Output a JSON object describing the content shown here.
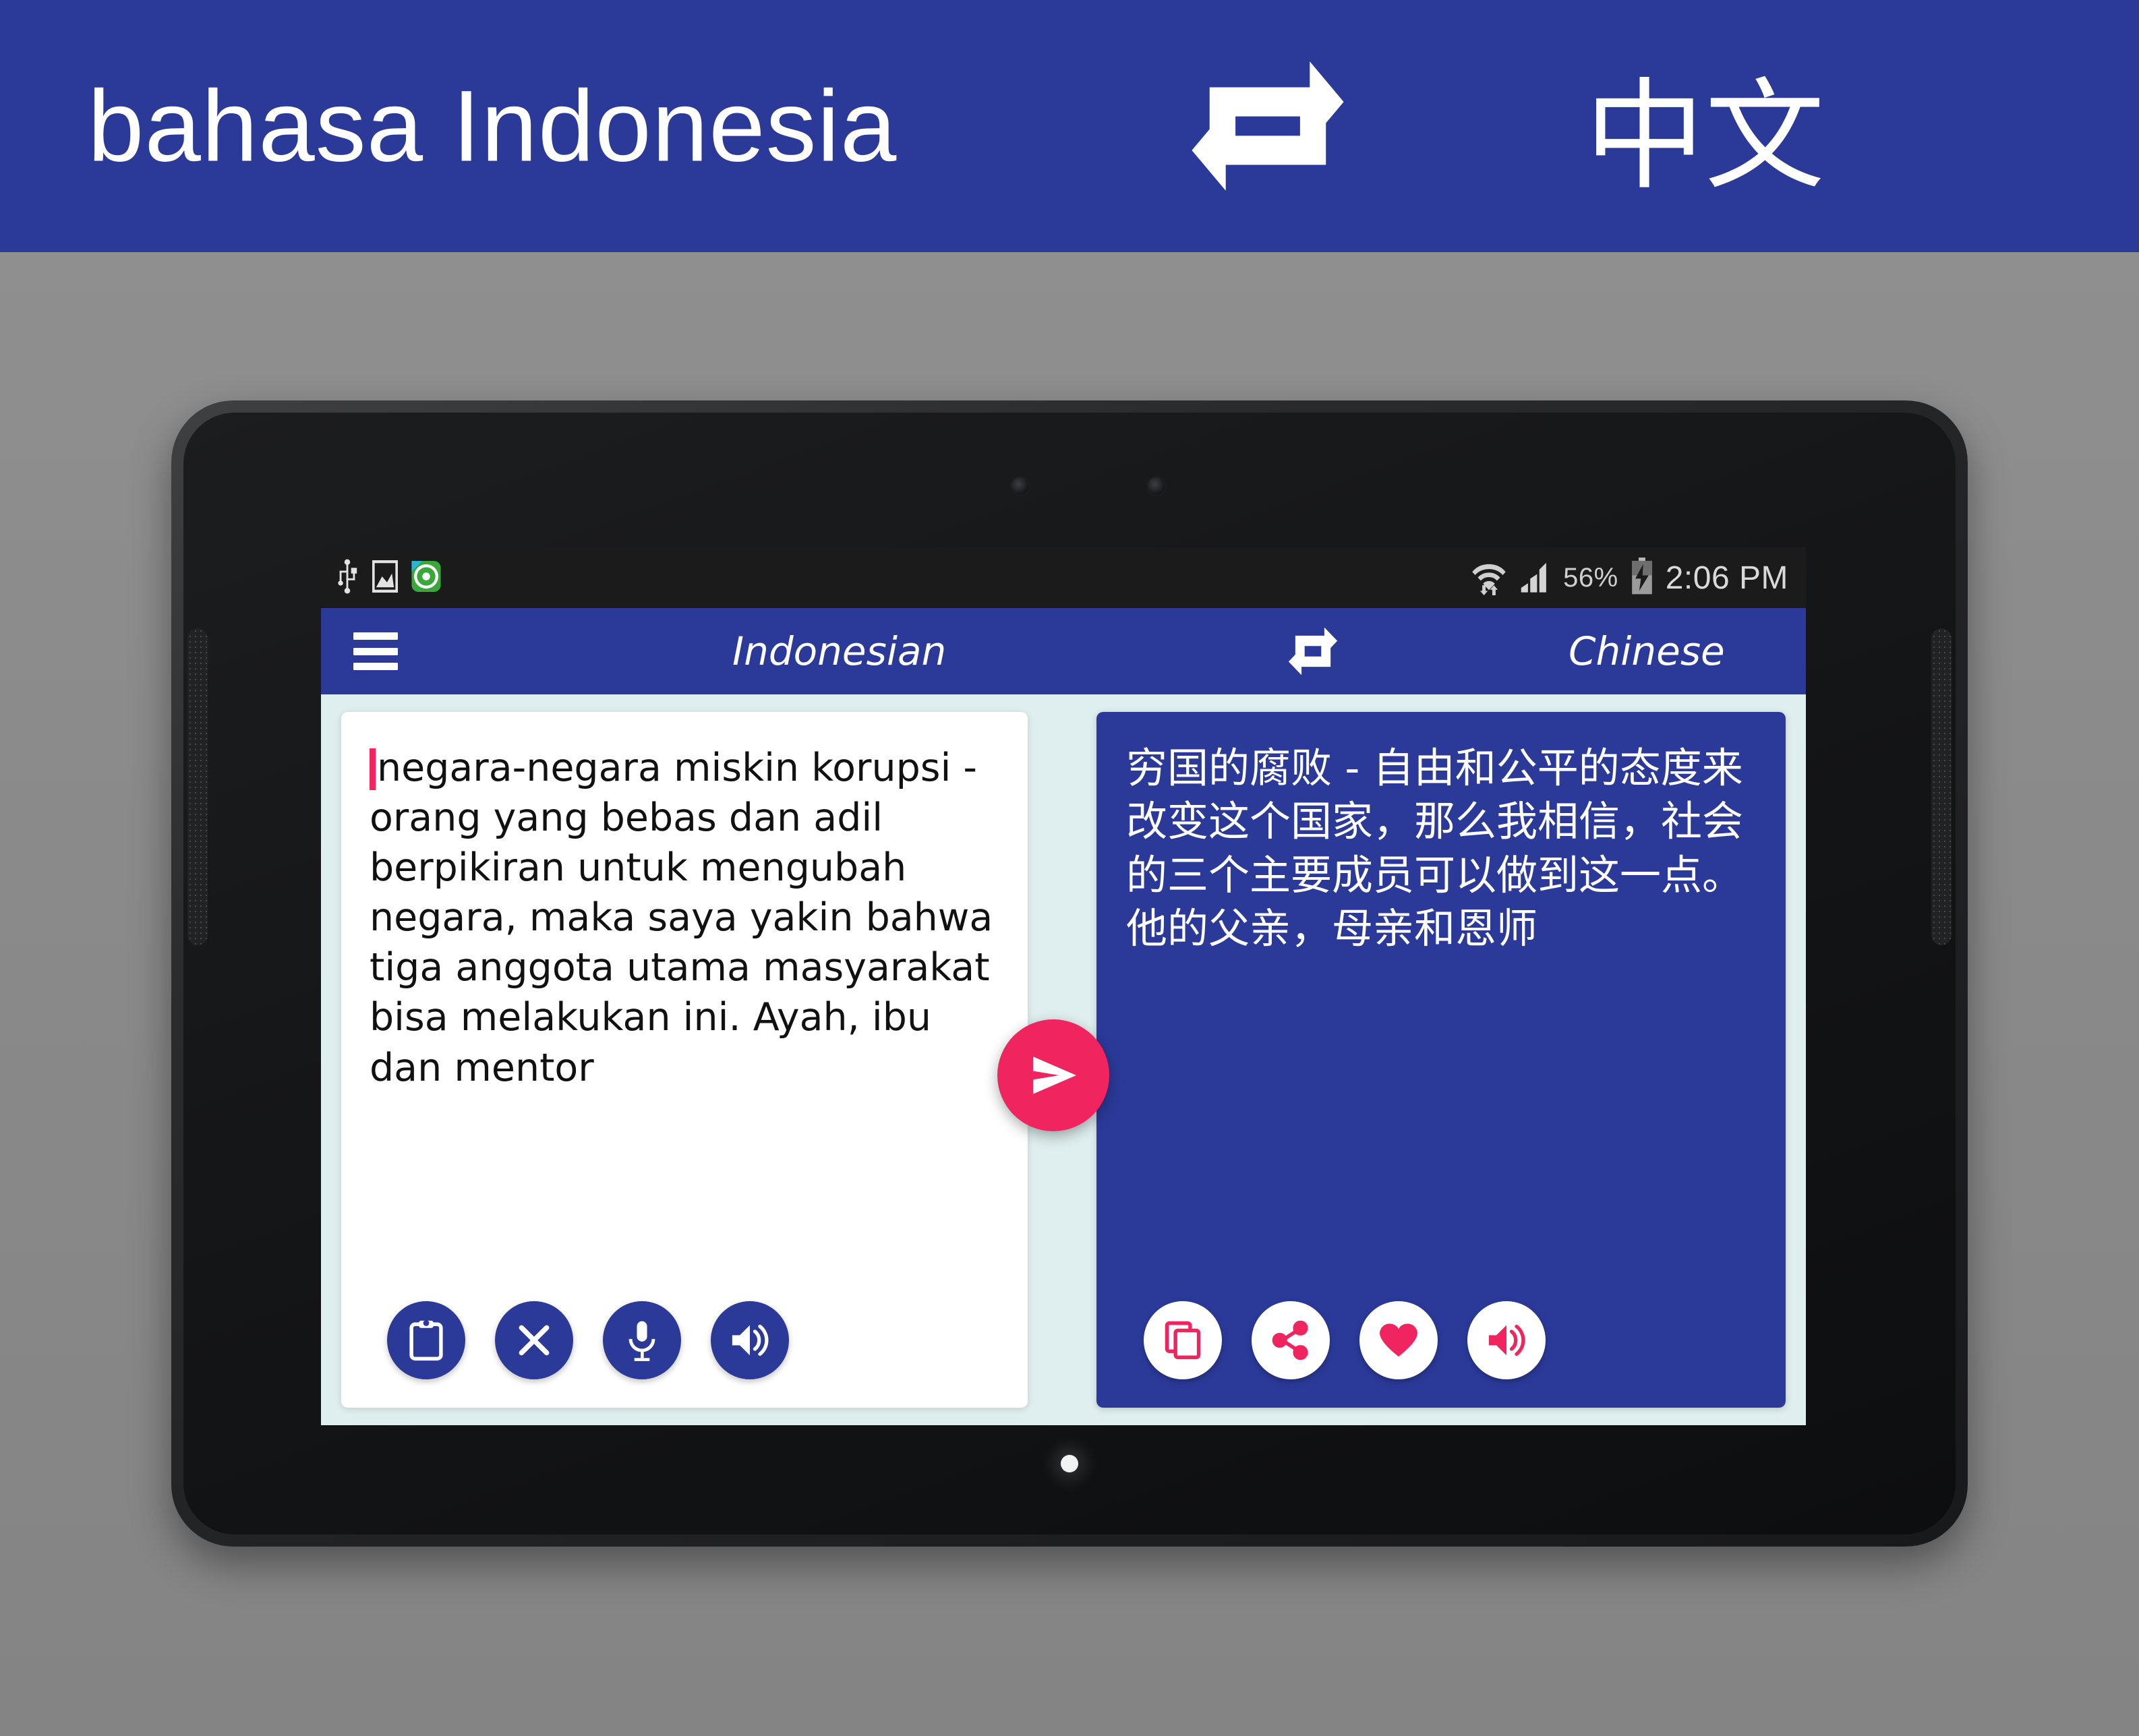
{
  "banner": {
    "left_language": "bahasa  Indonesia",
    "swap_icon": "swap-arrows-icon",
    "right_language": "中文",
    "background_color": "#2b3a99",
    "text_color": "#ffffff"
  },
  "device": {
    "type": "android-tablet",
    "led_indicator": "home-led-indicator"
  },
  "statusbar": {
    "left_icons": [
      "usb-icon",
      "screenshot-icon",
      "app-notification-icon"
    ],
    "wifi_icon": "wifi-icon",
    "signal_icon": "cellular-signal-icon",
    "battery_percent": "56%",
    "battery_icon": "battery-charging-icon",
    "time": "2:06 PM",
    "background_color": "#1b1b1b"
  },
  "appbar": {
    "menu_icon": "hamburger-menu-icon",
    "source_language": "Indonesian",
    "swap_icon": "swap-languages-icon",
    "target_language": "Chinese",
    "background_color": "#2b3a99"
  },
  "source_panel": {
    "text": "negara-negara miskin korupsi - orang yang bebas dan adil berpikiran untuk mengubah negara, maka saya yakin bahwa tiga anggota utama masyarakat bisa melakukan ini. Ayah, ibu dan mentor",
    "background_color": "#ffffff",
    "text_color": "#111111",
    "caret_color": "#f0255f",
    "buttons": [
      {
        "name": "paste-button",
        "icon": "clipboard-icon"
      },
      {
        "name": "clear-button",
        "icon": "close-x-icon"
      },
      {
        "name": "voice-input-button",
        "icon": "microphone-icon"
      },
      {
        "name": "speak-source-button",
        "icon": "speaker-icon"
      }
    ]
  },
  "target_panel": {
    "text": "穷国的腐败 - 自由和公平的态度来改变这个国家，那么我相信，社会的三个主要成员可以做到这一点。他的父亲，母亲和恩师",
    "background_color": "#2b3a99",
    "text_color": "#ffffff",
    "buttons": [
      {
        "name": "copy-button",
        "icon": "copy-icon"
      },
      {
        "name": "share-button",
        "icon": "share-icon"
      },
      {
        "name": "favorite-button",
        "icon": "heart-icon"
      },
      {
        "name": "speak-target-button",
        "icon": "speaker-icon"
      }
    ]
  },
  "send_button": {
    "icon": "send-arrow-icon",
    "color": "#f0255f"
  },
  "theme": {
    "app_background": "#dfeeee",
    "primary": "#2b3a99",
    "accent": "#f0255f",
    "page_background": "#8c8c8c"
  }
}
